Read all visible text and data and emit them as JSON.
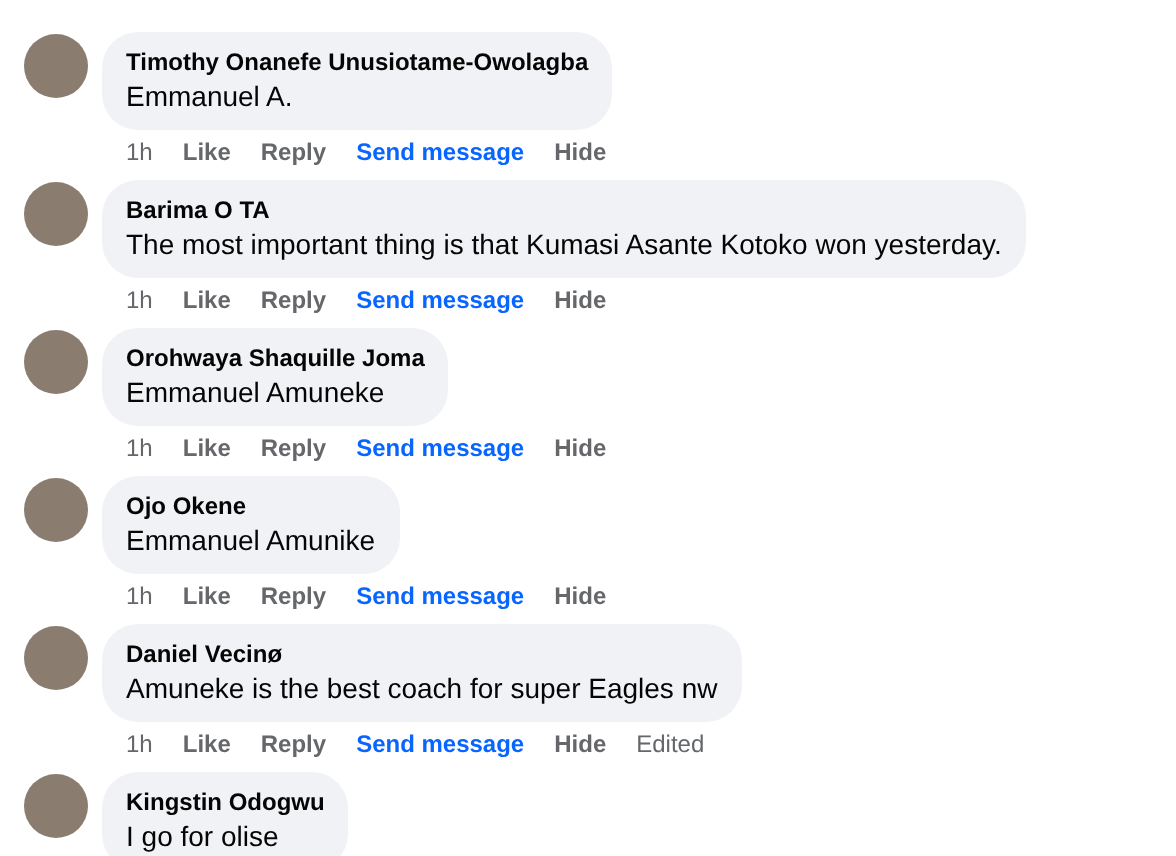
{
  "comments": [
    {
      "author": "Timothy Onanefe Unusiotame-Owolagba",
      "text": "Emmanuel A.",
      "actions": [
        {
          "kind": "time",
          "label": "1h"
        },
        {
          "kind": "action",
          "label": "Like"
        },
        {
          "kind": "action",
          "label": "Reply"
        },
        {
          "kind": "link",
          "label": "Send message"
        },
        {
          "kind": "action",
          "label": "Hide"
        }
      ]
    },
    {
      "author": "Barima O TA",
      "text": "The most important thing is that Kumasi Asante Kotoko won yesterday.",
      "actions": [
        {
          "kind": "time",
          "label": "1h"
        },
        {
          "kind": "action",
          "label": "Like"
        },
        {
          "kind": "action",
          "label": "Reply"
        },
        {
          "kind": "link",
          "label": "Send message"
        },
        {
          "kind": "action",
          "label": "Hide"
        }
      ]
    },
    {
      "author": "Orohwaya Shaquille Joma",
      "text": "Emmanuel Amuneke",
      "actions": [
        {
          "kind": "time",
          "label": "1h"
        },
        {
          "kind": "action",
          "label": "Like"
        },
        {
          "kind": "action",
          "label": "Reply"
        },
        {
          "kind": "link",
          "label": "Send message"
        },
        {
          "kind": "action",
          "label": "Hide"
        }
      ]
    },
    {
      "author": "Ojo Okene",
      "text": "Emmanuel Amunike",
      "actions": [
        {
          "kind": "time",
          "label": "1h"
        },
        {
          "kind": "action",
          "label": "Like"
        },
        {
          "kind": "action",
          "label": "Reply"
        },
        {
          "kind": "link",
          "label": "Send message"
        },
        {
          "kind": "action",
          "label": "Hide"
        }
      ]
    },
    {
      "author": "Daniel Vecinø",
      "text": "Amuneke is the best coach for super Eagles nw",
      "actions": [
        {
          "kind": "time",
          "label": "1h"
        },
        {
          "kind": "action",
          "label": "Like"
        },
        {
          "kind": "action",
          "label": "Reply"
        },
        {
          "kind": "link",
          "label": "Send message"
        },
        {
          "kind": "action",
          "label": "Hide"
        },
        {
          "kind": "edited",
          "label": "Edited"
        }
      ]
    },
    {
      "author": "Kingstin Odogwu",
      "text": "I go for olise"
    }
  ]
}
